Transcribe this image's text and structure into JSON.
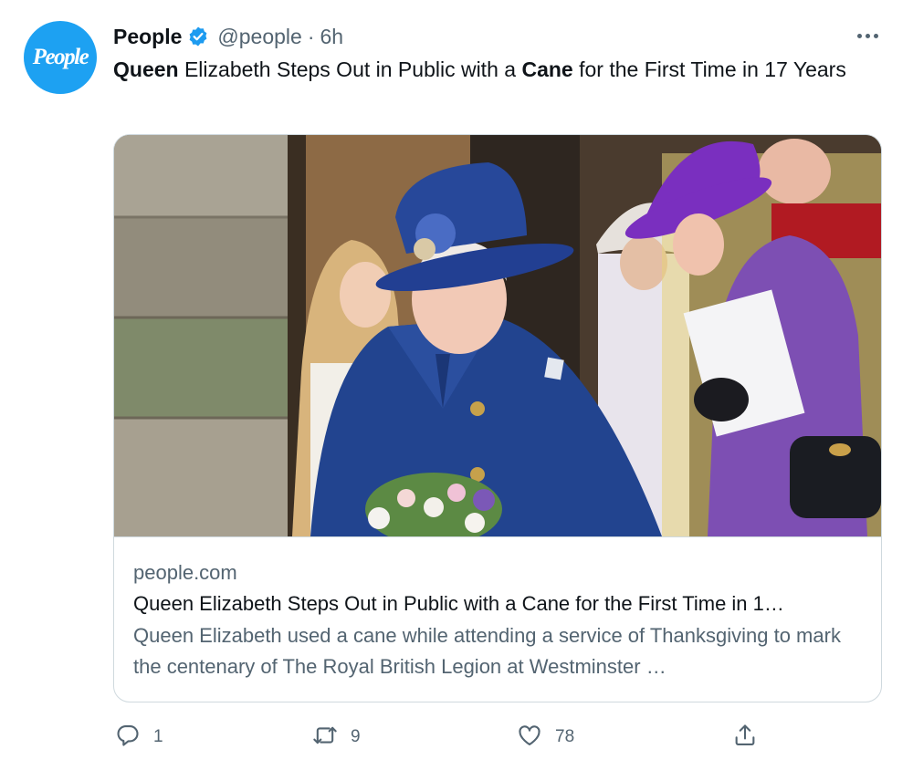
{
  "avatar": {
    "logo_text": "People"
  },
  "author": {
    "display_name": "People",
    "handle": "@people",
    "separator": "·",
    "time": "6h"
  },
  "tweet": {
    "text_part1": "Queen",
    "text_part2": " Elizabeth Steps Out in Public with a ",
    "text_part3": "Cane",
    "text_part4": " for the First Time in 17 Years"
  },
  "card": {
    "domain": "people.com",
    "title": "Queen Elizabeth Steps Out in Public with a Cane for the First Time in 1…",
    "description": "Queen Elizabeth used a cane while attending a service of Thanksgiving to mark the centenary of The Royal British Legion at Westminster …"
  },
  "actions": {
    "reply_count": "1",
    "retweet_count": "9",
    "like_count": "78"
  },
  "icons": {
    "verified": "verified-badge-icon",
    "more": "more-options-icon",
    "reply": "reply-icon",
    "retweet": "retweet-icon",
    "like": "like-icon",
    "share": "share-icon"
  },
  "colors": {
    "brand_blue": "#1da1f2",
    "text_primary": "#0f1419",
    "text_secondary": "#536471",
    "border": "#cfd9de"
  }
}
